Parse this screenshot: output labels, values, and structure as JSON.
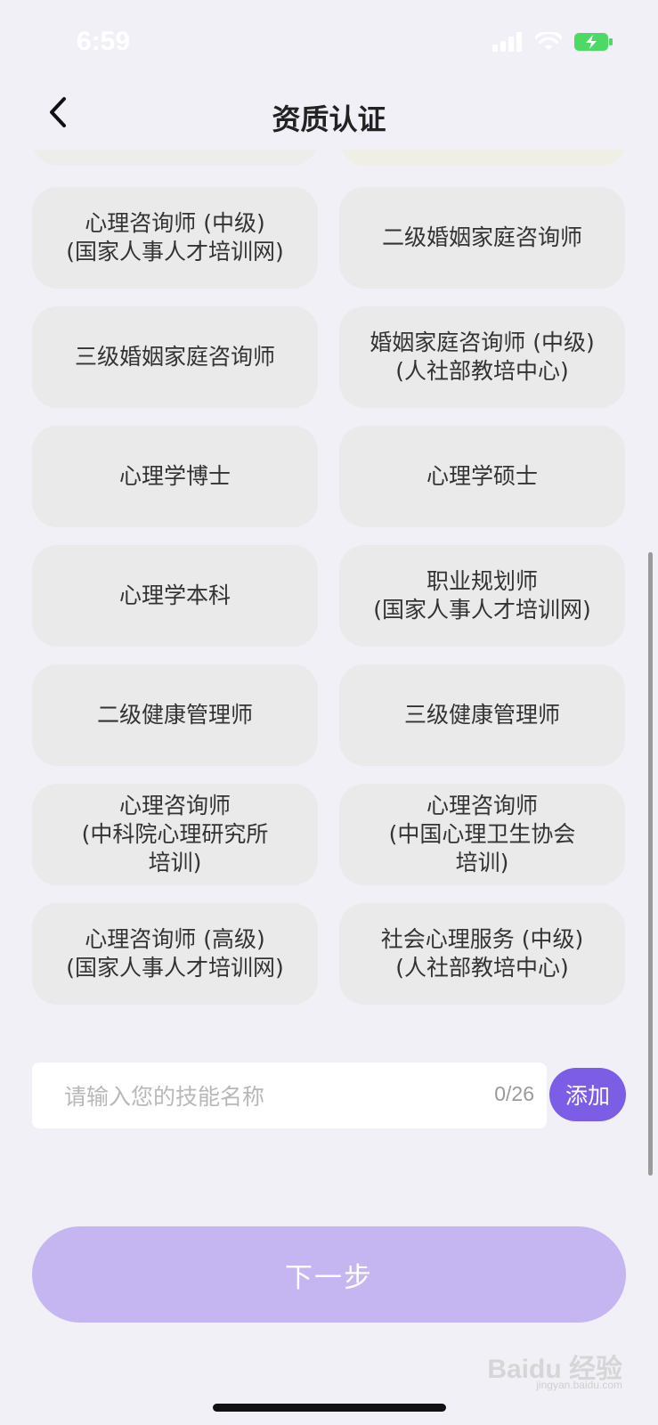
{
  "status_bar": {
    "time": "6:59",
    "icons": [
      "signal-icon",
      "wifi-icon",
      "battery-charging-icon"
    ],
    "battery_color": "#4cd964"
  },
  "header": {
    "title": "资质认证",
    "back_icon": "chevron-left-icon"
  },
  "qualifications": [
    {
      "label": "心理咨询师 (中级)\n(国家人事人才培训网)"
    },
    {
      "label": "二级婚姻家庭咨询师"
    },
    {
      "label": "三级婚姻家庭咨询师"
    },
    {
      "label": "婚姻家庭咨询师 (中级)\n(人社部教培中心)"
    },
    {
      "label": "心理学博士"
    },
    {
      "label": "心理学硕士"
    },
    {
      "label": "心理学本科"
    },
    {
      "label": "职业规划师\n(国家人事人才培训网)"
    },
    {
      "label": "二级健康管理师"
    },
    {
      "label": "三级健康管理师"
    },
    {
      "label": "心理咨询师\n(中科院心理研究所\n培训)"
    },
    {
      "label": "心理咨询师\n(中国心理卫生协会\n培训)"
    },
    {
      "label": "心理咨询师 (高级)\n(国家人事人才培训网)"
    },
    {
      "label": "社会心理服务 (中级)\n(人社部教培中心)"
    }
  ],
  "skill_input": {
    "placeholder": "请输入您的技能名称",
    "value": "",
    "counter": "0/26"
  },
  "add_button": {
    "label": "添加"
  },
  "next_button": {
    "label": "下一步"
  },
  "watermark": {
    "brand": "Baidu 经验",
    "url": "jingyan.baidu.com"
  },
  "colors": {
    "accent": "#7b5de6",
    "next_button_disabled": "#c5b6f1",
    "card_bg": "#eaeaea",
    "page_bg": "#f1f0f6"
  }
}
